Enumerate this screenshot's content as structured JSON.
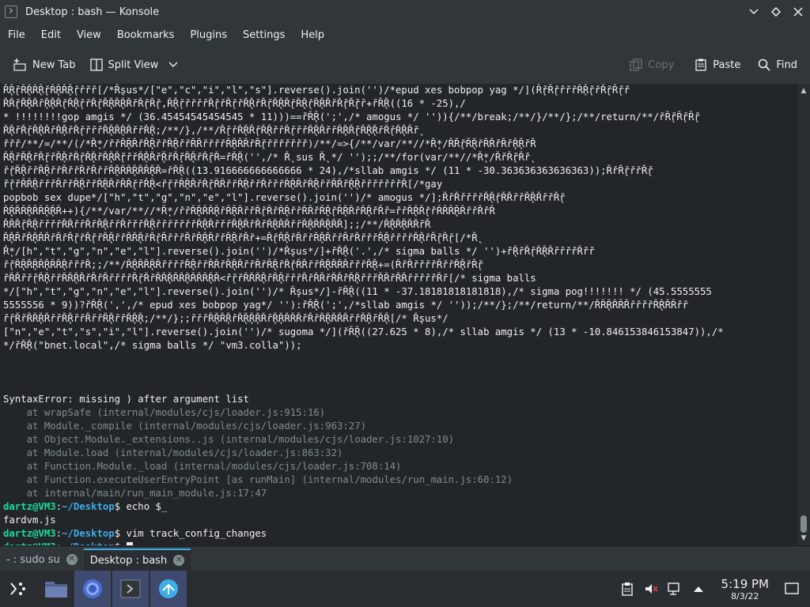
{
  "window": {
    "title": "Desktop : bash — Konsole"
  },
  "menu": [
    "File",
    "Edit",
    "View",
    "Bookmarks",
    "Plugins",
    "Settings",
    "Help"
  ],
  "toolbar": {
    "new_tab": "New Tab",
    "split_view": "Split View",
    "copy": "Copy",
    "paste": "Paste",
    "find": "Find"
  },
  "terminal": {
    "lines": [
      "Ř̨Ř̨řŘ̨ŘŘ̨Ř̨řŘ̨ŘŘ̨Ř̨řřřř[/*Ř̨sus*/[\"e\",\"c\",\"i\",\"l\",\"s\"].reverse().join('')/*epud xes bobpop yag */](Ř̨řŘ̨řřřřŘ̨Ř̨řřŘ̨řŘ̨řř",
      "ŘŘ̨řŘ̨ŘŘř̨Ř̨ŘŘ̨řŘ̨Ř̨řřŘ̨řŘ̨ŘŘ̨ŘŘřŘ̨řŘ̨ř,Ř̨Ř̨řřřřřŘ̨řřŘ̨řřŘ̨ŘřŘ̨řŘ̨ŘŘ̨řŘ̨Ř̨řŘ̨ŘŘřŘ̨řŘ̨řř+řŘ̨Ř((16 * -25),/",
      "* !!!!!!!!gop amgis */ (36.45454545454545 * 11)))==řŘ̨Ř(';',/* amogus */ '')){/**/break;/**/}/**/};/**/return/**/řŘ̨řŘ̨řŘ̨ř",
      "Ř̨ŘřŘ̨řŘ̨ŘŘřŘ̨ŘřŘ̨řřřřŘ̨ŘŘ̨ŘŘřřŘ̨Ř;/**/},/**/Ř̨řřŘ̨ŘŘ̨řŘ̨ŘřřŘ̨řřřŘ̨ŘŘřřŘ̨ŘŘ̨řŘ̨Ř̨ŘřŘ̨řŘ̨ŘŘř̨",
      "řřř/**/=/**/(/*Ř̨*/řřŘ̨ŘŘřŘ̨ŘřřŘ̨ŘřřŘŘřřřřŘ̨ŘŘŘřŘ̨řřřřřřřř)/**/=>{/**/var/**//*Ř̨*/ŘŘ̨řŘ̨ŘřŘŘřŘř̨Ř̨ŘřŘ",
      "Ř̨ŘřŘ̨ŘřŘ̨řřŘ̨ŘřŘ̨řŘ̨ŘřŘ̨ŘŘ̨řřřŘ̨ŘŘř̨ŘřŘ̨řŘ̨ŘřŘ̨řŘ=řŘ̨Ř('',/* Ř̨ sus Ř̨ */ '');;/**/for(var/**//*Ř̨*/ŘřŘ̨řŘř̨",
      "ř̨řŘ̨ŘřřŘ̨ŘřřŘřřŘřŘřřŘ̨ŘŘŘ̨ŘŘŘ̨ŘŘ=řŘ̨Ř((13.916666666666666 * 24),/*sllab amgis */ (11 * -30.363636363636363));ŘřŘ̨řřřŘ̨ř",
      "ř̨řřŘŘ̨ŘřřřŘřřŘ̨ŘřřŘ̨ŘŘřŘŘ̨řřŘ̨Ř<ř̨řřŘ̨ŘŘřŘ̨řŘŘřřŘ̨ŘřřŘřřřŘ̨ŘŘřŘ̨ŘřřŘŘř̨Ř̨ŘřřřřřřřŘ[/*gay",
      "popbob sex dupe*/[\"h\",\"t\",\"g\",\"n\",\"e\",\"l\"].reverse().join('')/* amogus */];ŘřŘřřřřŘ̨Ř̨řŘŘřřŘ̨ŘŘřřŘ̨ř",
      "Ř̨ŘŘŘ̨ŘŘŘ̨Ř̨ŘŘ++){/**/var/**//*Ř̨*/řřŘ̨ŘŘŘ̨ŘřŘ̨ŘŘřřŘ̨řŘřŘ̨ŘřřŘŘřŘ̨Ř̨řŘ̨ŘŘřŘ̨ŘřŘř=řřŘ̨ŘŘ̨řřŘŘŘ̨ŘŘřřŘřŘ",
      "ŘŘŘ̨řŘ̨ŘřřřřŘŘřřŘřŘ̨ŘřřŘřřřŘ̨ŘřřřřřřřŘ̨ŘŘřřřŘ̨ŘŘřŘřŘ̨ŘŘŘřřŘ̨ŘŘŘ̨ŘŘŘ];;/**/Ř̨ŘŘ̨ŘŘŘřŘ",
      "Ř̨ŘŘřŘ̨ŘŘŘřŘřŘ̨řřŘ̨řřŘ̨ŘřřŘŘ̨ŘřŘ̨řŘřřřŘřŘ̨ŘŘřřŘ̨ŘřŘř+=Ř̨řŘ̨ŘřŘřřŘ̨ŘŘřřŘřŘřřřŘ̨ŘřřřřŘ̨ŘřŘ̨řŘ̨ř[/*Ř̨",
      "Ř̨*/[h\",\"t\",\"g\",\"n\",\"e\",\"l\"].reverse().join('')/*Ř̨sus*/]+řŘ̨Ř('.',/* sigma balls */ '')+ř̨ŘřŘ̨řŘ̨ŘŘřřřřŘřř",
      "ř̨řŘ̨ŘŘ̨ŘŘ̨ŘŘŘ̨ŘřřřŘ;;/**/Ř̨ŘŘŘ̨ŘŘřřřřŘ̨ŘřřŘŘřŘ̨ŘŘřřŘřŘ̨ŘřŘ̨řŘŘřřŘ̨ŘŘŘŘřřřŘ̨Ř+=(ŘřŘřřřřŘřřŘ̨ŘřŘ̨ř",
      "řŘŘřř̨řŘ̨ŘřřŘŘ̨ŘŘřŘřŘřřřřŘ̨řŘřŘŘ̨ŘŘŘ̨ŘŘŘŘ̨ŘŘ<ř̨řřŘŘŘ̨ŘřŘ̨ŘřřřŘřŘŘřŘŘřŘ̨ŘřřřŘŘřŘŘřřřřřŘř[/* sigma balls",
      "*/[\"h\",\"t\",\"g\",\"n\",\"e\",\"l\"].reverse().join('')/* Ř̨sus*/]-řŘ̨Ř((11 * -37.18181818181818),/* sigma pog!!!!!!! */ (45.5555555",
      "5555556 * 9))?řŘ̨Ř(',',/* epud xes bobpop yag*/ ''):řŘ̨Ř(';',/*sllab amgis */ ''));/**/};/**/return/**/ŘŘ̨ŘŘŘŘřřřřŘ̨ŘŘŘřř",
      "ř̨řŘřŘŘ̨ŘŘřřŘ̨ŘřřŘřřŘ̨ŘřřŘ̨Ř̨Ř;/**/};;řřřŘ̨ŘŘ̨ŘřŘ̨Ř̨Ř̨ŘŘř̨Ř̨ŘŘŘŘřŘřŘ̨ŘŘŘŘřřŘ̨ŘřŘ̨Ř[/* Ř̨sus*/",
      "[\"n\",\"e\",\"t\",\"s\",\"i\",\"l\"].reverse().join('')/* sugoma */](řŘ̨Ř((27.625 * 8),/* sllab amgis */ (13 * -10.846153846153847)),/*",
      "*/řŘ̨Ř(\"bnet.local\",/* sigma balls */ \"vm3.colla\"));"
    ],
    "error": "SyntaxError: missing ) after argument list",
    "trace": [
      "    at wrapSafe (internal/modules/cjs/loader.js:915:16)",
      "    at Module._compile (internal/modules/cjs/loader.js:963:27)",
      "    at Object.Module._extensions..js (internal/modules/cjs/loader.js:1027:10)",
      "    at Module.load (internal/modules/cjs/loader.js:863:32)",
      "    at Function.Module._load (internal/modules/cjs/loader.js:708:14)",
      "    at Function.executeUserEntryPoint [as runMain] (internal/modules/run_main.js:60:12)",
      "    at internal/main/run_main_module.js:17:47"
    ],
    "prompt_user": "dartz@VM3",
    "prompt_path": "~/Desktop",
    "prompt_sep": ":",
    "prompt_end": "$",
    "cmd1": " echo $_",
    "out1": "fardvm.js",
    "cmd2": " vim track_config_changes",
    "cmd3": " "
  },
  "tabs": [
    {
      "label": "- : sudo su"
    },
    {
      "label": "Desktop : bash"
    }
  ],
  "panel": {
    "time": "5:19 PM",
    "date": "8/3/22"
  },
  "colors": {
    "background": "#232629",
    "prompt_user": "#1cdc9a",
    "prompt_path": "#3daee9",
    "trace": "#7f8c8d"
  }
}
